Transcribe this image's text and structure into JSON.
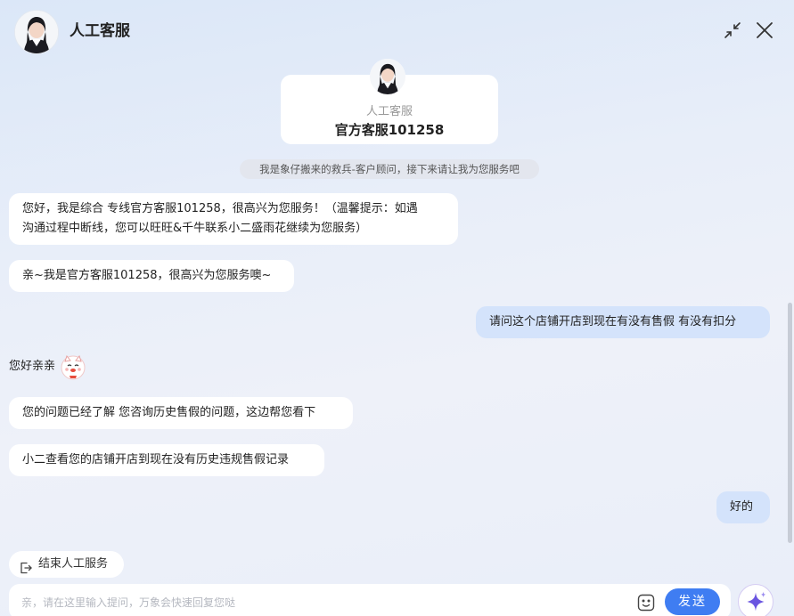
{
  "header": {
    "title": "人工客服"
  },
  "agent_card": {
    "role": "人工客服",
    "name": "官方客服101258"
  },
  "notice": "我是象仔搬来的救兵-客户顾问，接下来请让我为您服务吧",
  "messages": {
    "m1_line1": "您好，我是综合 专线官方客服101258，很高兴为您服务！（温馨提示：如遇",
    "m1_line2": "沟通过程中断线，您可以旺旺&千牛联系小二盛雨花继续为您服务）",
    "m2": "亲~我是官方客服101258，很高兴为您服务噢~",
    "u1": "请问这个店铺开店到现在有没有售假 有没有扣分",
    "m3": "您好亲亲",
    "m4": "您的问题已经了解 您咨询历史售假的问题，这边帮您看下",
    "m5": "小二查看您的店铺开店到现在没有历史违规售假记录",
    "u2": "好的"
  },
  "end_service_label": "结束人工服务",
  "input": {
    "placeholder": "亲，请在这里输入提问，万象会快速回复您哒",
    "value": ""
  },
  "send_label": "发送",
  "icons": [
    "avatar",
    "minimize-icon",
    "close-icon",
    "cat-emoji-icon",
    "exit-icon",
    "emoji-icon",
    "sparkle-icon"
  ],
  "colors": {
    "accent": "#3f7df2",
    "user_bubble": "#d4e3fb",
    "sparkle": "#6a55e0"
  }
}
